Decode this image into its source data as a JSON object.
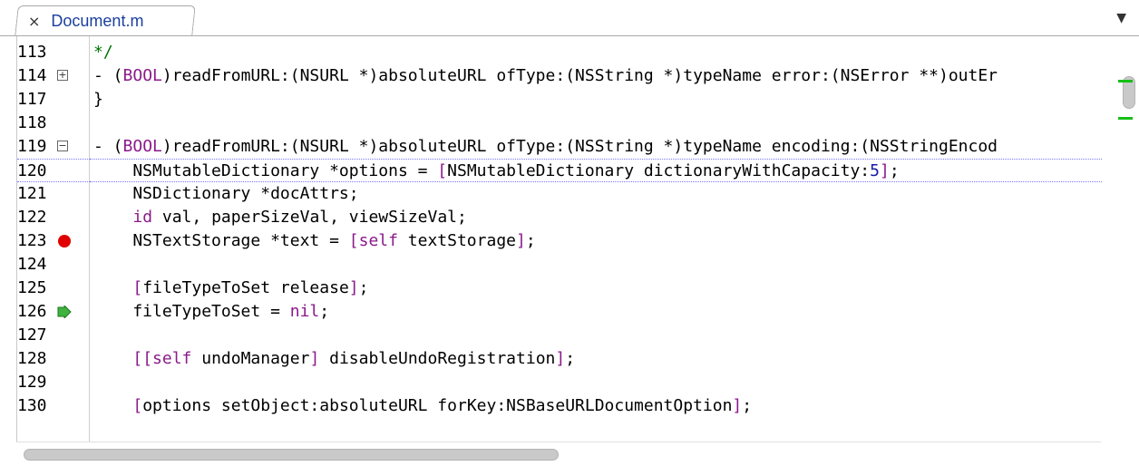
{
  "tab": {
    "close_glyph": "×",
    "label": "Document.m",
    "dropdown_glyph": "▼"
  },
  "lines": [
    {
      "num": "113",
      "marker": "",
      "tokens": [
        {
          "t": "*/",
          "c": "cm"
        }
      ]
    },
    {
      "num": "114",
      "marker": "fold-plus",
      "tokens": [
        {
          "t": "- (",
          "c": ""
        },
        {
          "t": "BOOL",
          "c": "kw"
        },
        {
          "t": ")readFromURL:(NSURL *)absoluteURL ofType:(NSString *)typeName error:(NSError **)outEr",
          "c": ""
        }
      ]
    },
    {
      "num": "117",
      "marker": "",
      "tokens": [
        {
          "t": "}",
          "c": ""
        }
      ]
    },
    {
      "num": "118",
      "marker": "",
      "tokens": []
    },
    {
      "num": "119",
      "marker": "fold-minus",
      "tokens": [
        {
          "t": "- (",
          "c": ""
        },
        {
          "t": "BOOL",
          "c": "kw"
        },
        {
          "t": ")readFromURL:(NSURL *)absoluteURL ofType:(NSString *)typeName encoding:(NSStringEncod",
          "c": ""
        }
      ]
    },
    {
      "num": "120",
      "marker": "",
      "current": true,
      "tokens": [
        {
          "t": "    NSMutableDictionary *options = ",
          "c": ""
        },
        {
          "t": "[",
          "c": "kw"
        },
        {
          "t": "NSMutableDictionary dictionaryWithCapacity:",
          "c": ""
        },
        {
          "t": "5",
          "c": "num"
        },
        {
          "t": "]",
          "c": "kw"
        },
        {
          "t": ";",
          "c": ""
        }
      ]
    },
    {
      "num": "121",
      "marker": "",
      "tokens": [
        {
          "t": "    NSDictionary *docAttrs;",
          "c": ""
        }
      ]
    },
    {
      "num": "122",
      "marker": "",
      "tokens": [
        {
          "t": "    ",
          "c": ""
        },
        {
          "t": "id",
          "c": "kw"
        },
        {
          "t": " val, paperSizeVal, viewSizeVal;",
          "c": ""
        }
      ]
    },
    {
      "num": "123",
      "marker": "breakpoint",
      "tokens": [
        {
          "t": "    NSTextStorage *text = ",
          "c": ""
        },
        {
          "t": "[self",
          "c": "kw"
        },
        {
          "t": " textStorage",
          "c": ""
        },
        {
          "t": "]",
          "c": "kw"
        },
        {
          "t": ";",
          "c": ""
        }
      ]
    },
    {
      "num": "124",
      "marker": "",
      "tokens": []
    },
    {
      "num": "125",
      "marker": "",
      "tokens": [
        {
          "t": "    ",
          "c": ""
        },
        {
          "t": "[",
          "c": "kw"
        },
        {
          "t": "fileTypeToSet release",
          "c": ""
        },
        {
          "t": "]",
          "c": "kw"
        },
        {
          "t": ";",
          "c": ""
        }
      ]
    },
    {
      "num": "126",
      "marker": "pc-arrow",
      "tokens": [
        {
          "t": "    fileTypeToSet = ",
          "c": ""
        },
        {
          "t": "nil",
          "c": "kw"
        },
        {
          "t": ";",
          "c": ""
        }
      ]
    },
    {
      "num": "127",
      "marker": "",
      "tokens": []
    },
    {
      "num": "128",
      "marker": "",
      "tokens": [
        {
          "t": "    ",
          "c": ""
        },
        {
          "t": "[[self",
          "c": "kw"
        },
        {
          "t": " undoManager",
          "c": ""
        },
        {
          "t": "]",
          "c": "kw"
        },
        {
          "t": " disableUndoRegistration",
          "c": ""
        },
        {
          "t": "]",
          "c": "kw"
        },
        {
          "t": ";",
          "c": ""
        }
      ]
    },
    {
      "num": "129",
      "marker": "",
      "tokens": []
    },
    {
      "num": "130",
      "marker": "",
      "tokens": [
        {
          "t": "    ",
          "c": ""
        },
        {
          "t": "[",
          "c": "kw"
        },
        {
          "t": "options setObject:absoluteURL forKey:NSBaseURLDocumentOption",
          "c": ""
        },
        {
          "t": "]",
          "c": "kw"
        },
        {
          "t": ";",
          "c": ""
        }
      ]
    }
  ],
  "colors": {
    "keyword": "#8b1a8b",
    "number": "#1a1aa6",
    "comment": "#007400",
    "breakpoint": "#e00000",
    "change_marker": "#16c016",
    "tab_label": "#1a3f9e"
  },
  "icons": {
    "fold_plus": "plus-square-icon",
    "fold_minus": "minus-square-icon",
    "breakpoint": "breakpoint-icon",
    "pc": "program-counter-arrow-icon"
  }
}
